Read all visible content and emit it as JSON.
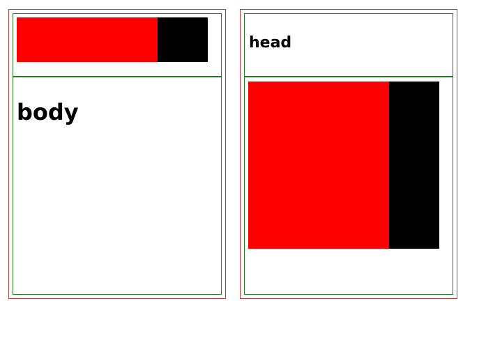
{
  "panels": [
    {
      "body_label": "body"
    },
    {
      "head_label": "head"
    }
  ],
  "colors": {
    "outer_border": "#c23b3b",
    "inner_border": "#1f7f1f",
    "accent_red": "#ff0000",
    "accent_black": "#000000"
  }
}
